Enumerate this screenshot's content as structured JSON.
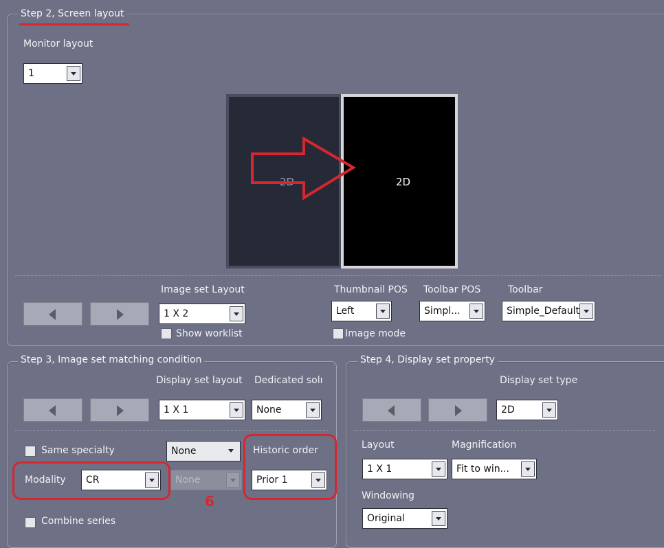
{
  "step2": {
    "title": "Step 2, Screen layout",
    "monitor_layout_label": "Monitor layout",
    "monitor_layout_value": "1",
    "preview": {
      "left_label": "2D",
      "right_label": "2D"
    },
    "image_set_layout_label": "Image set Layout",
    "image_set_layout_value": "1 X 2",
    "show_worklist_label": "Show worklist",
    "thumbnail_pos_label": "Thumbnail POS",
    "thumbnail_pos_value": "Left",
    "toolbar_pos_label": "Toolbar POS",
    "toolbar_pos_value": "Simpl...",
    "toolbar_label": "Toolbar",
    "toolbar_value": "Simple_Default",
    "image_mode_label": "Image mode"
  },
  "step3": {
    "title": "Step 3, Image set matching condition",
    "display_set_layout_label": "Display set layout",
    "display_set_layout_value": "1 X 1",
    "dedicated_label": "Dedicated solı",
    "dedicated_value": "None",
    "same_specialty_label": "Same specialty",
    "specialty_value": "None",
    "historic_order_label": "Historic order",
    "historic_order_value": "Prior 1",
    "modality_label": "Modality",
    "modality_value": "CR",
    "secondary_value": "None",
    "annotation_number": "6",
    "combine_series_label": "Combine series"
  },
  "step4": {
    "title": "Step 4, Display set property",
    "display_set_type_label": "Display set type",
    "display_set_type_value": "2D",
    "layout_label": "Layout",
    "layout_value": "1 X 1",
    "magnification_label": "Magnification",
    "magnification_value": "Fit to win...",
    "windowing_label": "Windowing",
    "windowing_value": "Original"
  },
  "colors": {
    "background": "#6e7185",
    "callout_red": "#d62630",
    "preview_left": "#262a37",
    "preview_right": "#000000"
  },
  "icons": [
    "arrow-left-icon",
    "arrow-right-icon",
    "dropdown-arrow-icon",
    "annotation-arrow"
  ]
}
